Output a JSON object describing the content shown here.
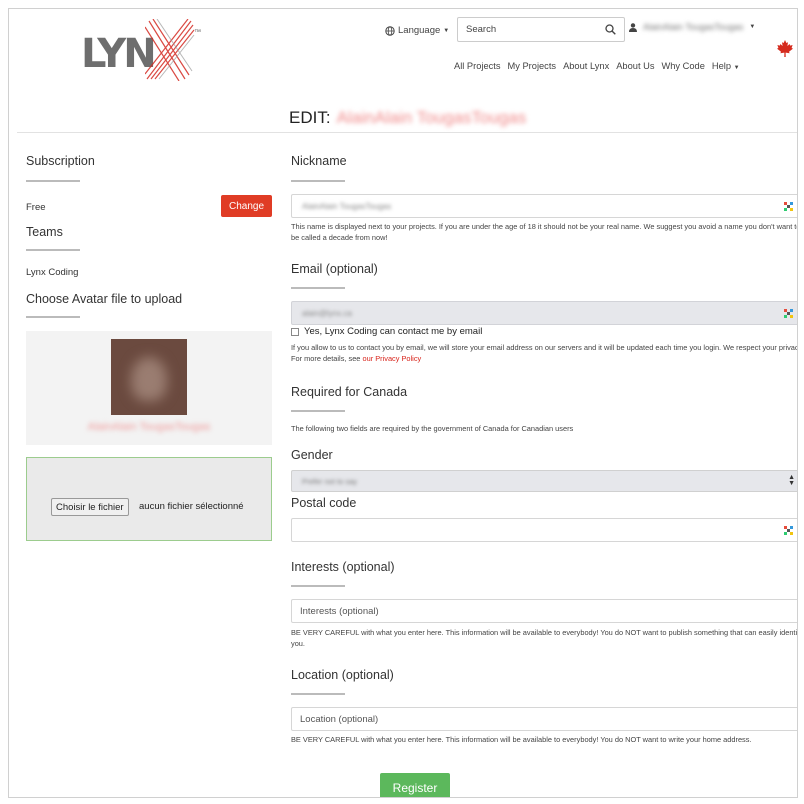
{
  "header": {
    "logo_text": "LYN",
    "logo_tm": "™",
    "language_label": "Language",
    "search": {
      "placeholder": "Search"
    },
    "user_name": "AlainAlain TougasTougas",
    "nav": [
      {
        "label": "All Projects"
      },
      {
        "label": "My Projects"
      },
      {
        "label": "About Lynx"
      },
      {
        "label": "About Us"
      },
      {
        "label": "Why Code"
      },
      {
        "label": "Help"
      }
    ],
    "flag_color": "#d52b1e"
  },
  "page": {
    "edit_prefix": "EDIT:",
    "edit_name": "AlainAlain TougasTougas"
  },
  "sidebar": {
    "subscription_heading": "Subscription",
    "plan": "Free",
    "change_label": "Change",
    "teams_heading": "Teams",
    "team_name": "Lynx Coding",
    "avatar_heading": "Choose Avatar file to upload",
    "avatar_name": "AlainAlain TougasTougas",
    "file_button": "Choisir le fichier",
    "file_status": "aucun fichier sélectionné"
  },
  "form": {
    "nickname": {
      "label": "Nickname",
      "value": "AlainAlain TougasTougas",
      "help": "This name is displayed next to your projects. If you are under the age of 18 it should not be your real name. We suggest you avoid a name you don't want to be called a decade from now!"
    },
    "email": {
      "label": "Email (optional)",
      "value": "alain@lynx.ca",
      "contact_label": "Yes, Lynx Coding can contact me by email",
      "help": "If you allow to us to contact you by email, we will store your email address on our servers and it will be updated each time you login. We respect your privacy. For more details, see",
      "privacy_link": "our Privacy Policy"
    },
    "canada": {
      "heading": "Required for Canada",
      "help": "The following two fields are required by the government of Canada for Canadian users"
    },
    "gender": {
      "label": "Gender",
      "selected": "Prefer not to say"
    },
    "postal": {
      "label": "Postal code"
    },
    "interests": {
      "label": "Interests (optional)",
      "placeholder": "Interests (optional)",
      "help": "BE VERY CAREFUL with what you enter here. This information will be available to everybody! You do NOT want to publish something that can easily identify you."
    },
    "location": {
      "label": "Location (optional)",
      "placeholder": "Location (optional)",
      "help": "BE VERY CAREFUL with what you enter here. This information will be available to everybody! You do NOT want to write your home address."
    },
    "register_label": "Register"
  },
  "colors": {
    "accent_red": "#e03c25",
    "register_green": "#5cb85c",
    "upload_border": "#9ccc8e"
  }
}
